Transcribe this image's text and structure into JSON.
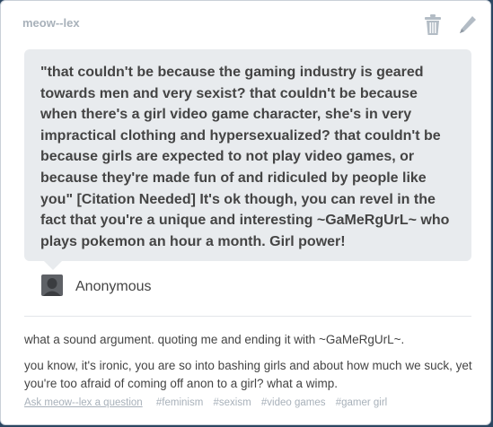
{
  "post": {
    "username": "meow--lex",
    "question": "\"that couldn't be because the gaming industry is geared towards men and very sexist? that couldn't be because when there's a girl video game character, she's in very impractical clothing and hypersexualized? that couldn't be because girls are expected to not play video games, or because they're made fun of and ridiculed by people like you\" [Citation Needed] It's ok though, you can revel in the fact that you're a unique and interesting ~GaMeRgUrL~ who plays pokemon an hour a month. Girl power!",
    "asker": "Anonymous",
    "answer": [
      "what a sound argument. quoting me and ending it with ~GaMeRgUrL~.",
      "you know, it's ironic, you are so into bashing girls and about how much we suck, yet you're too afraid of coming off anon to a girl? what a wimp."
    ],
    "ask_link": "Ask meow--lex a question",
    "tags": [
      "#feminism",
      "#sexism",
      "#video games",
      "#gamer girl"
    ]
  },
  "icons": {
    "delete": "trash-icon",
    "edit": "pencil-icon",
    "avatar": "anonymous-avatar-icon"
  },
  "colors": {
    "page_bg": "#2c4762",
    "bubble_bg": "#e8ebee",
    "muted_text": "#a8b1ba"
  }
}
